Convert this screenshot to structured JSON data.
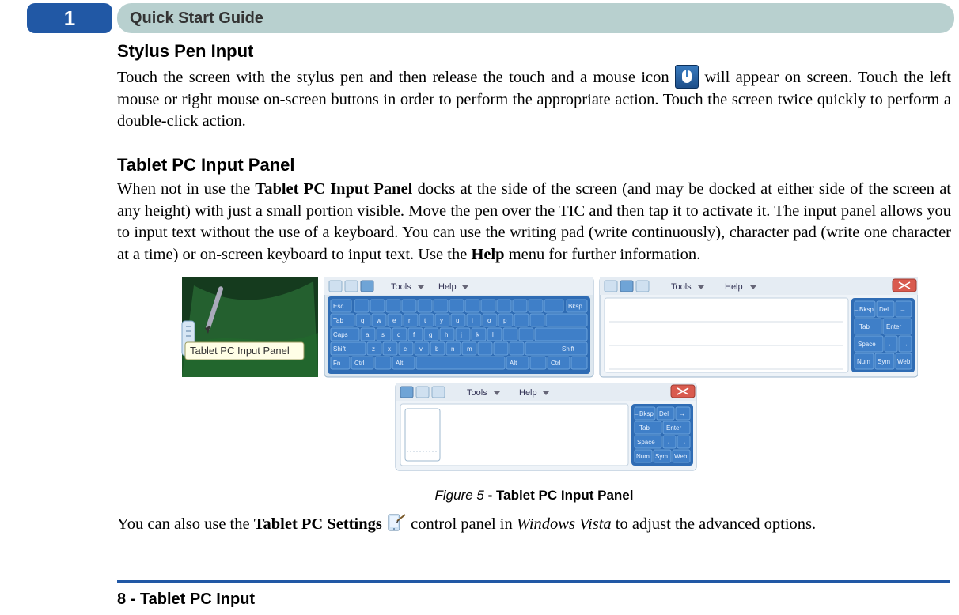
{
  "chapter_number": "1",
  "header_title": "Quick Start Guide",
  "section1": {
    "title": "Stylus Pen Input",
    "p1_before_icon": "Touch the screen with the stylus pen and then release the touch and a mouse icon ",
    "p1_after_icon": " will appear on screen. Touch the left mouse or right mouse on-screen buttons in order to perform the appropriate action. Touch the screen twice quickly to perform a double-click action."
  },
  "section2": {
    "title": "Tablet PC Input Panel",
    "p1_a": "When not in use the ",
    "p1_bold1": "Tablet PC Input Panel",
    "p1_b": " docks at the side of the screen (and may be docked at either side of the screen at any height) with just a small portion visible. Move the pen over the TIC and then tap it to activate it. The input panel allows you to input text without the use of a keyboard. You can use the writing pad (write continuously), character pad (write one character at a time) or on-screen keyboard to input text. Use the ",
    "p1_bold2": "Help",
    "p1_c": " menu for further information."
  },
  "figure": {
    "label": "Figure  5",
    "separator": " - ",
    "title": "Tablet PC Input Panel",
    "panel_tooltip": "Tablet PC Input Panel",
    "menu_tools": "Tools",
    "menu_help": "Help",
    "side_keys": [
      "Bksp",
      "Del",
      "Tab",
      "Enter",
      "Space",
      "Num",
      "Sym",
      "Web"
    ],
    "osk_rows": {
      "r1_left": "Esc",
      "r1_right": "Bksp",
      "r2_left": "Tab",
      "r3_left": "Caps",
      "r4_left": "Shift",
      "r4_right": "Shift",
      "r5": [
        "Fn",
        "Ctrl",
        "",
        "Alt",
        "",
        "Alt",
        "",
        "Ctrl",
        ""
      ],
      "letters_r2": [
        "q",
        "w",
        "e",
        "r",
        "t",
        "y",
        "u",
        "i",
        "o",
        "p",
        "[",
        "]"
      ],
      "letters_r3": [
        "a",
        "s",
        "d",
        "f",
        "g",
        "h",
        "j",
        "k",
        "l",
        ";",
        "'"
      ],
      "letters_r4": [
        "z",
        "x",
        "c",
        "v",
        "b",
        "n",
        "m",
        ",",
        ".",
        "/"
      ]
    }
  },
  "paragraph3": {
    "a": "You can also use the ",
    "bold": "Tablet PC Settings",
    "b": " ",
    "c": " control panel in ",
    "italic": "Windows Vista",
    "d": " to adjust the advanced options."
  },
  "footer": "8 - Tablet PC Input",
  "colors": {
    "accent": "#2158a5",
    "header_bg": "#b8d0cf"
  }
}
